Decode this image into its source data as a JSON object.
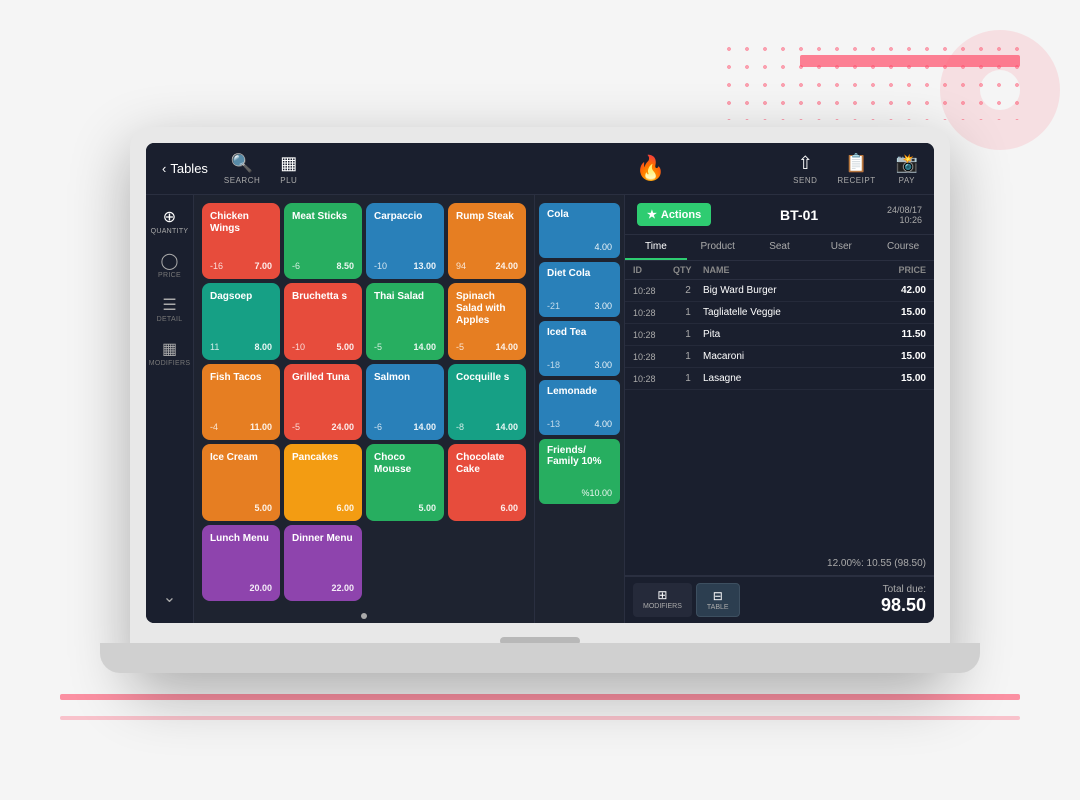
{
  "header": {
    "back_label": "Tables",
    "search_label": "SEARCH",
    "plu_label": "PLU",
    "send_label": "SEND",
    "receipt_label": "RECEIPT",
    "pay_label": "PAY"
  },
  "sidebar": {
    "buttons": [
      {
        "id": "quantity",
        "label": "QUANTITY",
        "icon": "⊕"
      },
      {
        "id": "price",
        "label": "PRICE",
        "icon": "⊙"
      },
      {
        "id": "detail",
        "label": "DETAIL",
        "icon": "☰"
      },
      {
        "id": "modifiers",
        "label": "MODIFIERS",
        "icon": "⊞"
      }
    ]
  },
  "menu_items": [
    {
      "name": "Chicken Wings",
      "color": "item-red",
      "num": "-16",
      "price": "7.00"
    },
    {
      "name": "Meat Sticks",
      "color": "item-green",
      "num": "-6",
      "price": "8.50"
    },
    {
      "name": "Carpaccio",
      "color": "item-blue",
      "num": "-10",
      "price": "13.00"
    },
    {
      "name": "Rump Steak",
      "color": "item-orange",
      "num": "94",
      "price": "24.00"
    },
    {
      "name": "Dagsoep",
      "color": "item-teal",
      "num": "11",
      "price": "8.00"
    },
    {
      "name": "Bruchetta s",
      "color": "item-red",
      "num": "-10",
      "price": "5.00"
    },
    {
      "name": "Thai Salad",
      "color": "item-green",
      "num": "-5",
      "price": "14.00"
    },
    {
      "name": "Spinach Salad with Apples",
      "color": "item-orange",
      "num": "-5",
      "price": "14.00"
    },
    {
      "name": "Fish Tacos",
      "color": "item-orange",
      "num": "-4",
      "price": "11.00"
    },
    {
      "name": "Grilled Tuna",
      "color": "item-red",
      "num": "-5",
      "price": "24.00"
    },
    {
      "name": "Salmon",
      "color": "item-blue",
      "num": "-6",
      "price": "14.00"
    },
    {
      "name": "Cocquille s",
      "color": "item-teal",
      "num": "-8",
      "price": "14.00"
    },
    {
      "name": "Ice Cream",
      "color": "item-orange",
      "num": "",
      "price": "5.00"
    },
    {
      "name": "Pancakes",
      "color": "item-yellow",
      "num": "",
      "price": "6.00"
    },
    {
      "name": "Choco Mousse",
      "color": "item-green",
      "num": "",
      "price": "5.00"
    },
    {
      "name": "Chocolate Cake",
      "color": "item-red",
      "num": "",
      "price": "6.00"
    },
    {
      "name": "Lunch Menu",
      "color": "item-purple",
      "num": "",
      "price": "20.00"
    },
    {
      "name": "Dinner Menu",
      "color": "item-purple",
      "num": "",
      "price": "22.00"
    }
  ],
  "drinks": [
    {
      "name": "Cola",
      "color": "drink-blue",
      "num": "4.00",
      "qty": ""
    },
    {
      "name": "Diet Cola",
      "color": "drink-blue",
      "num": "3.00",
      "qty": "-21"
    },
    {
      "name": "Iced Tea",
      "color": "drink-blue",
      "num": "3.00",
      "qty": "-18"
    },
    {
      "name": "Lemonade",
      "color": "drink-blue",
      "num": "4.00",
      "qty": "-13"
    },
    {
      "name": "Friends/ Family 10%",
      "color": "drink-green-special",
      "num": "%10.00",
      "qty": ""
    }
  ],
  "order": {
    "actions_label": "Actions",
    "table_id": "BT-01",
    "date": "24/08/17",
    "time": "10:26",
    "tabs": [
      "Time",
      "Product",
      "Seat",
      "User",
      "Course"
    ],
    "active_tab": "Time",
    "columns": [
      "ID",
      "QTY",
      "NAME",
      "PRICE"
    ],
    "rows": [
      {
        "time": "10:28",
        "qty": "2",
        "name": "Big Ward Burger",
        "price": "42.00"
      },
      {
        "time": "10:28",
        "qty": "1",
        "name": "Tagliatelle Veggie",
        "price": "15.00"
      },
      {
        "time": "10:28",
        "qty": "1",
        "name": "Pita",
        "price": "11.50"
      },
      {
        "time": "10:28",
        "qty": "1",
        "name": "Macaroni",
        "price": "15.00"
      },
      {
        "time": "10:28",
        "qty": "1",
        "name": "Lasagne",
        "price": "15.00"
      }
    ],
    "tax_line": "12.00%: 10.55 (98.50)",
    "total_label": "Total due:",
    "total_amount": "98.50",
    "footer_buttons": [
      {
        "id": "modifiers",
        "label": "MODIFIERS",
        "icon": "⊞"
      },
      {
        "id": "table",
        "label": "TABLE",
        "icon": "⊟"
      }
    ]
  }
}
